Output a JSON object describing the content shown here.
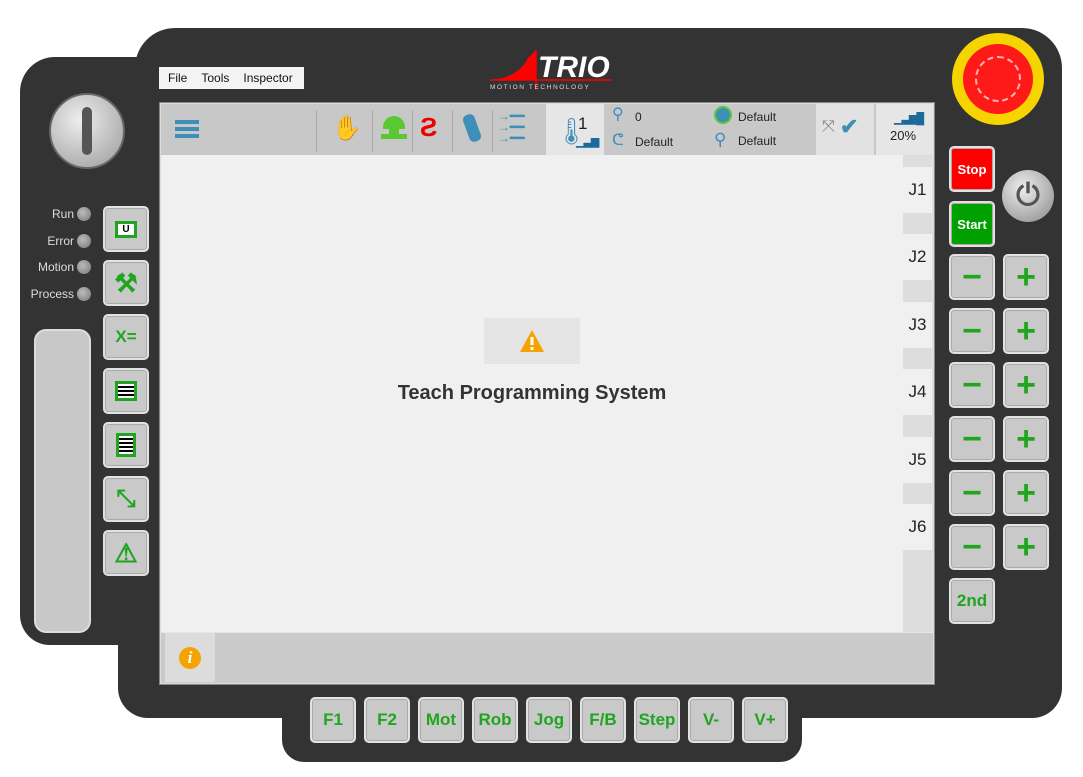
{
  "menu": {
    "items": [
      "File",
      "Tools",
      "Inspector"
    ]
  },
  "logo": {
    "text": "TRIO",
    "subtitle": "MOTION TECHNOLOGY"
  },
  "leds": [
    "Run",
    "Error",
    "Motion",
    "Process"
  ],
  "toolbar": {
    "user_level": "1",
    "tool_number": "0",
    "gripper": "Default",
    "base_frame": "Default",
    "user_frame": "Default",
    "speed": "20%"
  },
  "main": {
    "title": "Teach Programming System"
  },
  "joints": [
    "J1",
    "J2",
    "J3",
    "J4",
    "J5",
    "J6"
  ],
  "right": {
    "stop": "Stop",
    "start": "Start",
    "minus": "−",
    "plus": "+",
    "second": "2nd"
  },
  "fkeys": [
    "F1",
    "F2",
    "Mot",
    "Rob",
    "Jog",
    "F/B",
    "Step",
    "V-",
    "V+"
  ],
  "colors": {
    "accent": "#1fa51f",
    "toolbar_icon": "#3d8fb8",
    "stop": "#ff0000",
    "start": "#00a000",
    "warning": "#f5a300"
  }
}
